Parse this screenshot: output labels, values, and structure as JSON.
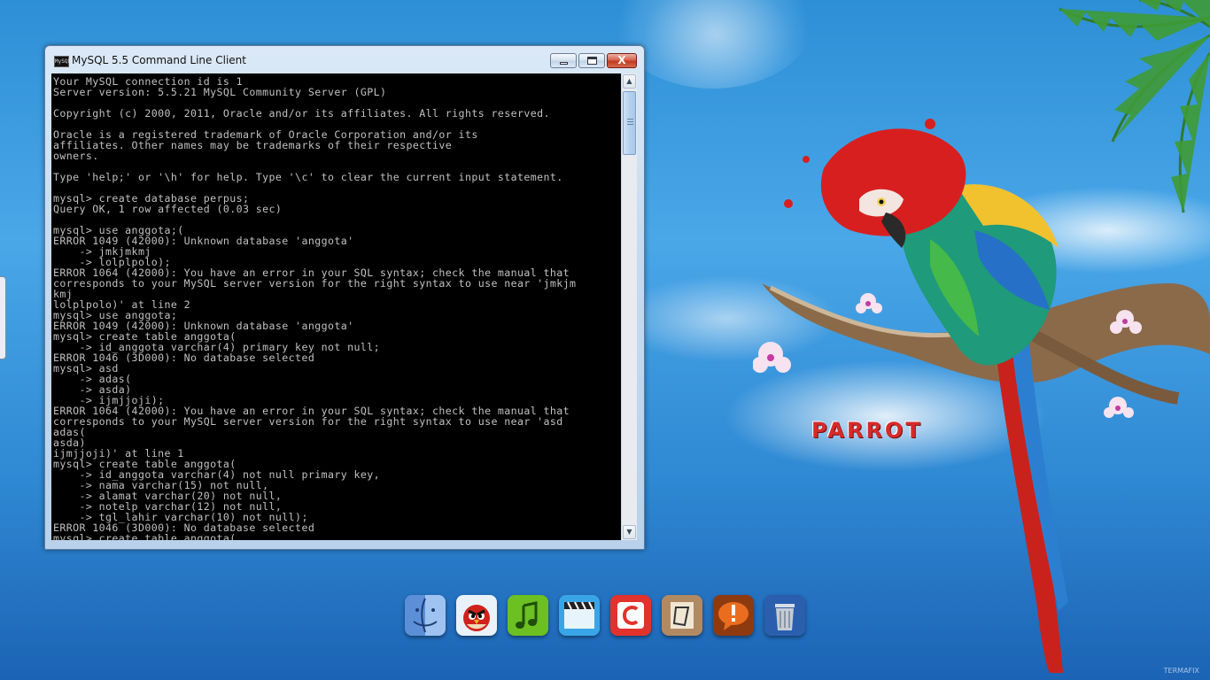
{
  "window": {
    "title": "MySQL 5.5 Command Line Client",
    "app_icon_label": "MySQL",
    "minimize_label": "",
    "maximize_label": "",
    "close_label": "X"
  },
  "console": {
    "text": "Your MySQL connection id is 1\nServer version: 5.5.21 MySQL Community Server (GPL)\n\nCopyright (c) 2000, 2011, Oracle and/or its affiliates. All rights reserved.\n\nOracle is a registered trademark of Oracle Corporation and/or its\naffiliates. Other names may be trademarks of their respective\nowners.\n\nType 'help;' or '\\h' for help. Type '\\c' to clear the current input statement.\n\nmysql> create database perpus;\nQuery OK, 1 row affected (0.03 sec)\n\nmysql> use anggota;(\nERROR 1049 (42000): Unknown database 'anggota'\n    -> jmkjmkmj\n    -> lolplpolo);\nERROR 1064 (42000): You have an error in your SQL syntax; check the manual that\ncorresponds to your MySQL server version for the right syntax to use near 'jmkjm\nkmj\nlolplpolo)' at line 2\nmysql> use anggota;\nERROR 1049 (42000): Unknown database 'anggota'\nmysql> create table anggota(\n    -> id_anggota varchar(4) primary key not null;\nERROR 1046 (3D000): No database selected\nmysql> asd\n    -> adas(\n    -> asda)\n    -> ijmjjoji);\nERROR 1064 (42000): You have an error in your SQL syntax; check the manual that\ncorresponds to your MySQL server version for the right syntax to use near 'asd\nadas(\nasda)\nijmjjoji)' at line 1\nmysql> create table anggota(\n    -> id_anggota varchar(4) not null primary key,\n    -> nama varchar(15) not null,\n    -> alamat varchar(20) not null,\n    -> notelp varchar(12) not null,\n    -> tgl_lahir varchar(10) not null);\nERROR 1046 (3D000): No database selected\nmysql> create table anggota("
  },
  "scrollbar": {
    "up_arrow": "▲",
    "down_arrow": "▼"
  },
  "wallpaper": {
    "logo_text": "PARROT",
    "watermark": "TERMAFIX"
  },
  "dock": {
    "items": [
      {
        "icon": "finder-icon"
      },
      {
        "icon": "angry-birds-icon"
      },
      {
        "icon": "music-icon"
      },
      {
        "icon": "video-icon"
      },
      {
        "icon": "calendar-app-icon"
      },
      {
        "icon": "notes-app-icon"
      },
      {
        "icon": "alert-app-icon"
      },
      {
        "icon": "trash-icon"
      }
    ]
  },
  "colors": {
    "console_bg": "#000000",
    "console_fg": "#c0c0c0",
    "desktop_blue": "#2f89d3",
    "close_red": "#c13b22"
  }
}
